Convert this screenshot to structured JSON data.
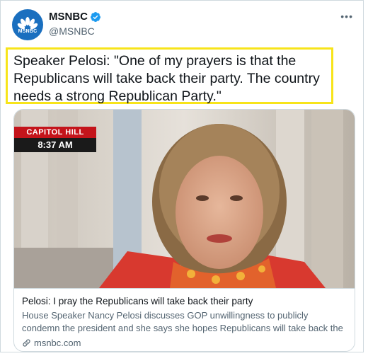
{
  "account": {
    "display_name": "MSNBC",
    "handle": "@MSNBC",
    "avatar_text": "MSNBC",
    "verified": true
  },
  "tweet": {
    "text": "Speaker Pelosi: \"One of my prayers is that the Republicans will take back their party. The country needs a strong Republican Party.\"",
    "highlight_color": "#f7e41a"
  },
  "card": {
    "chyron_top": "CAPITOL HILL",
    "chyron_time": "8:37 AM",
    "title": "Pelosi: I pray the Republicans will take back their party",
    "description": "House Speaker Nancy Pelosi discusses GOP unwillingness to publicly condemn the president and she says she hopes Republicans will take back the party from the ...",
    "domain": "msnbc.com"
  },
  "colors": {
    "brand_blue": "#1a6fbf",
    "chyron_red": "#c4141b",
    "secondary_text": "#536471"
  },
  "icons": [
    "peacock-logo-icon",
    "verified-badge-icon",
    "more-options-icon",
    "link-icon"
  ]
}
